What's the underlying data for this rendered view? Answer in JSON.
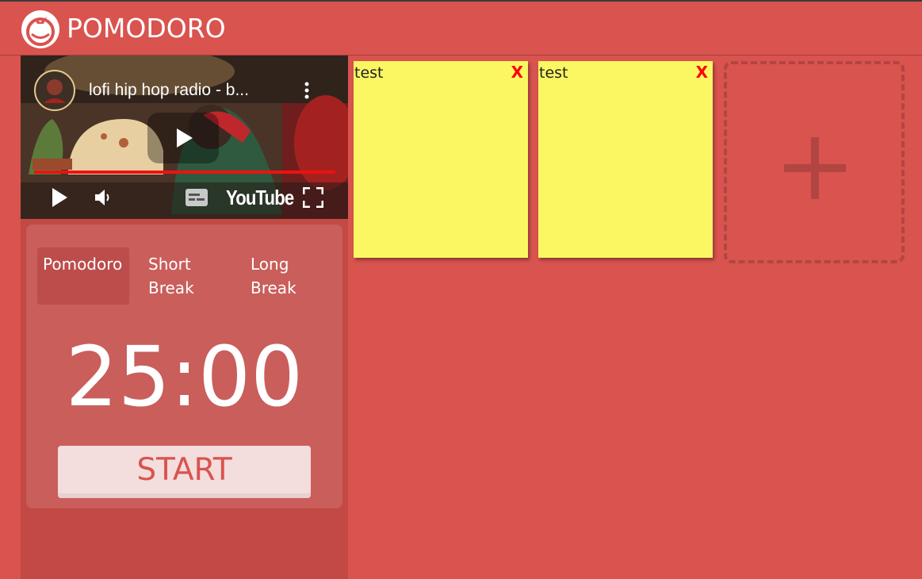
{
  "app": {
    "title": "POMODORO",
    "logo_icon": "tomato-icon"
  },
  "colors": {
    "background": "#d9534f",
    "sidebar": "#c34945",
    "timer_card": "#c95e5b",
    "note": "#faf763",
    "close": "#ff0000"
  },
  "video": {
    "title": "lofi hip hop radio - b...",
    "brand": "YouTube",
    "icons": [
      "play-icon",
      "volume-icon",
      "subtitles-icon",
      "fullscreen-icon",
      "more-options-icon"
    ]
  },
  "timer": {
    "tabs": [
      {
        "label": "Pomodoro",
        "active": true
      },
      {
        "label": "Short Break",
        "active": false
      },
      {
        "label": "Long Break",
        "active": false
      }
    ],
    "display": "25:00",
    "start_label": "START"
  },
  "notes": [
    {
      "text": "test",
      "close_label": "X"
    },
    {
      "text": "test",
      "close_label": "X"
    }
  ],
  "add_note": {
    "icon": "plus-icon"
  }
}
